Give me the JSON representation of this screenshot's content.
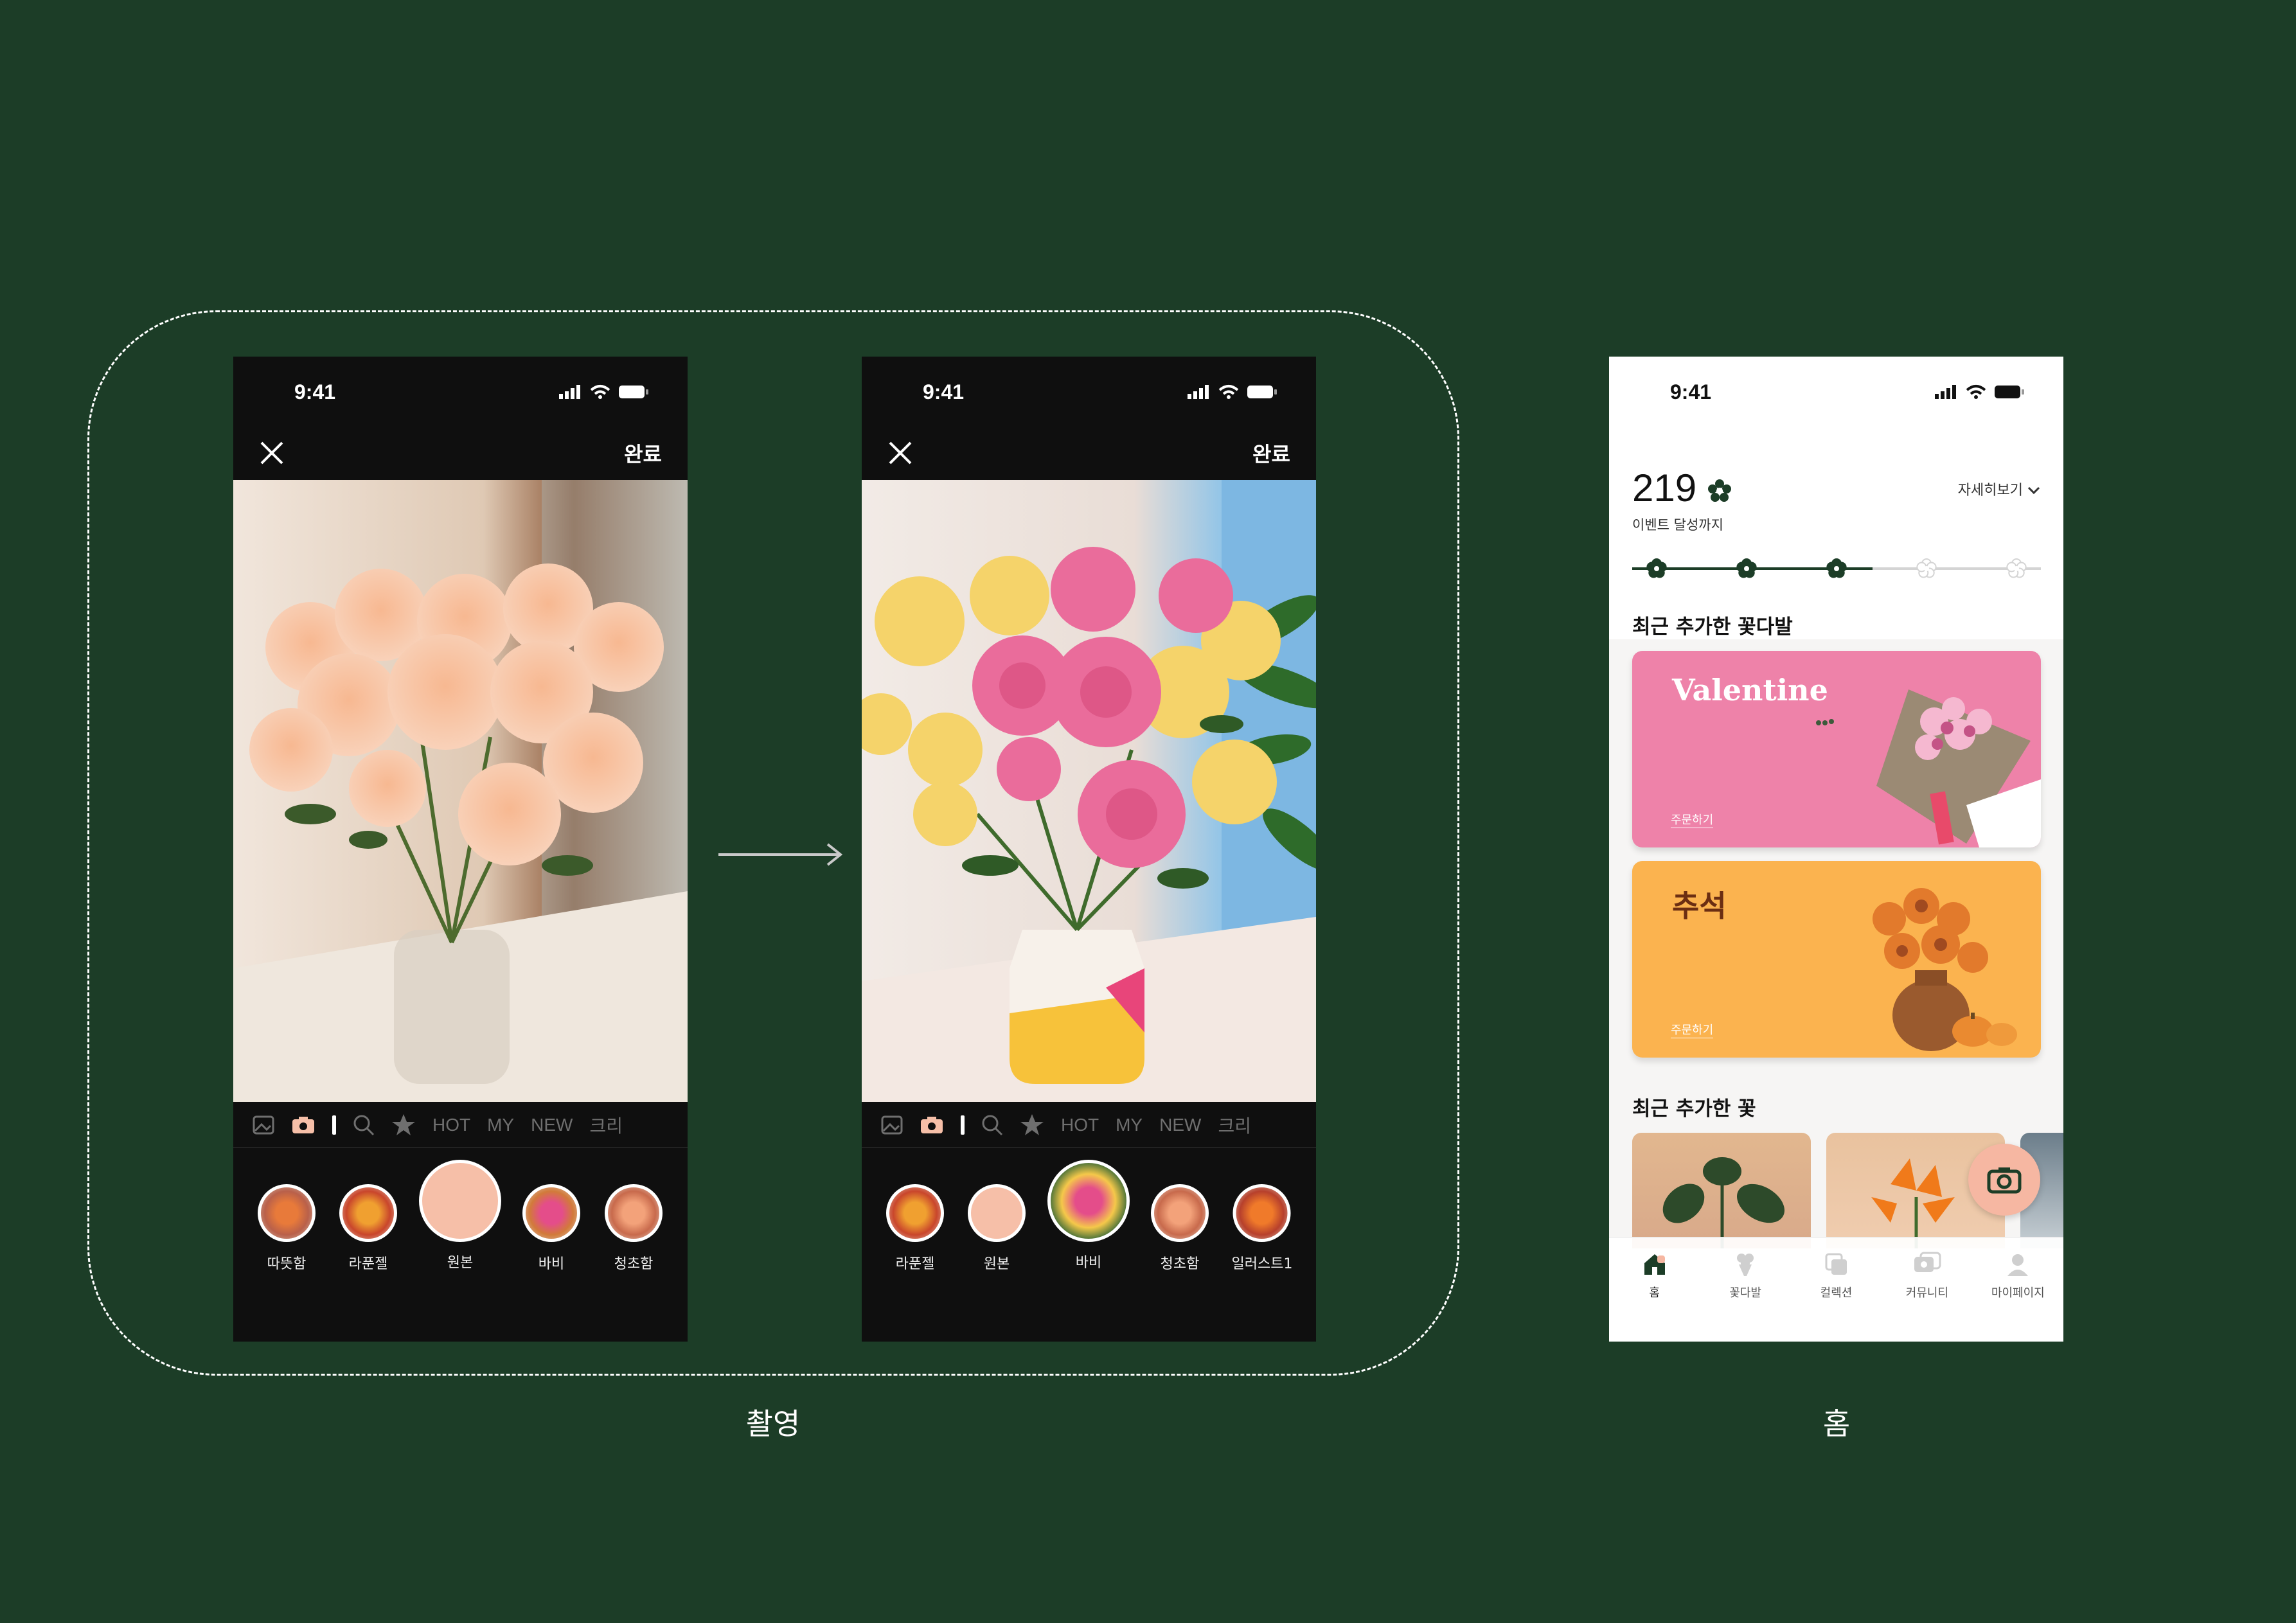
{
  "colors": {
    "background": "#1c3d27",
    "phone_dark": "#0f0f0f",
    "accent_peach": "#f6bfa8",
    "banner_pink": "#ee82a9",
    "banner_orange": "#fbb34f",
    "progress_green": "#1c3d27"
  },
  "captions": {
    "shooting": "촬영",
    "home": "홈"
  },
  "screen1": {
    "time": "9:41",
    "close_icon": "close-icon",
    "done": "완료",
    "toolstrip": [
      "HOT",
      "MY",
      "NEW",
      "크리"
    ],
    "filters": [
      {
        "label": "따뜻함",
        "selected": false
      },
      {
        "label": "라푼젤",
        "selected": false
      },
      {
        "label": "원본",
        "selected": true
      },
      {
        "label": "바비",
        "selected": false
      },
      {
        "label": "청초함",
        "selected": false
      }
    ]
  },
  "screen2": {
    "time": "9:41",
    "done": "완료",
    "toolstrip": [
      "HOT",
      "MY",
      "NEW",
      "크리"
    ],
    "filters": [
      {
        "label": "라푼젤",
        "selected": false
      },
      {
        "label": "원본",
        "selected": false
      },
      {
        "label": "바비",
        "selected": true
      },
      {
        "label": "청초함",
        "selected": false
      },
      {
        "label": "일러스트1",
        "selected": false
      }
    ]
  },
  "home": {
    "time": "9:41",
    "score": "219",
    "score_sub": "이벤트 달성까지",
    "detail": "자세히보기",
    "progress_fraction": 0.6,
    "section_bouquet": "최근 추가한 꽃다발",
    "banners": [
      {
        "title": "Valentine",
        "order": "주문하기"
      },
      {
        "title": "추석",
        "order": "주문하기"
      }
    ],
    "section_flower": "최근 추가한 꽃",
    "tabs": [
      "홈",
      "꽃다발",
      "컬렉션",
      "커뮤니티",
      "마이페이지"
    ]
  }
}
